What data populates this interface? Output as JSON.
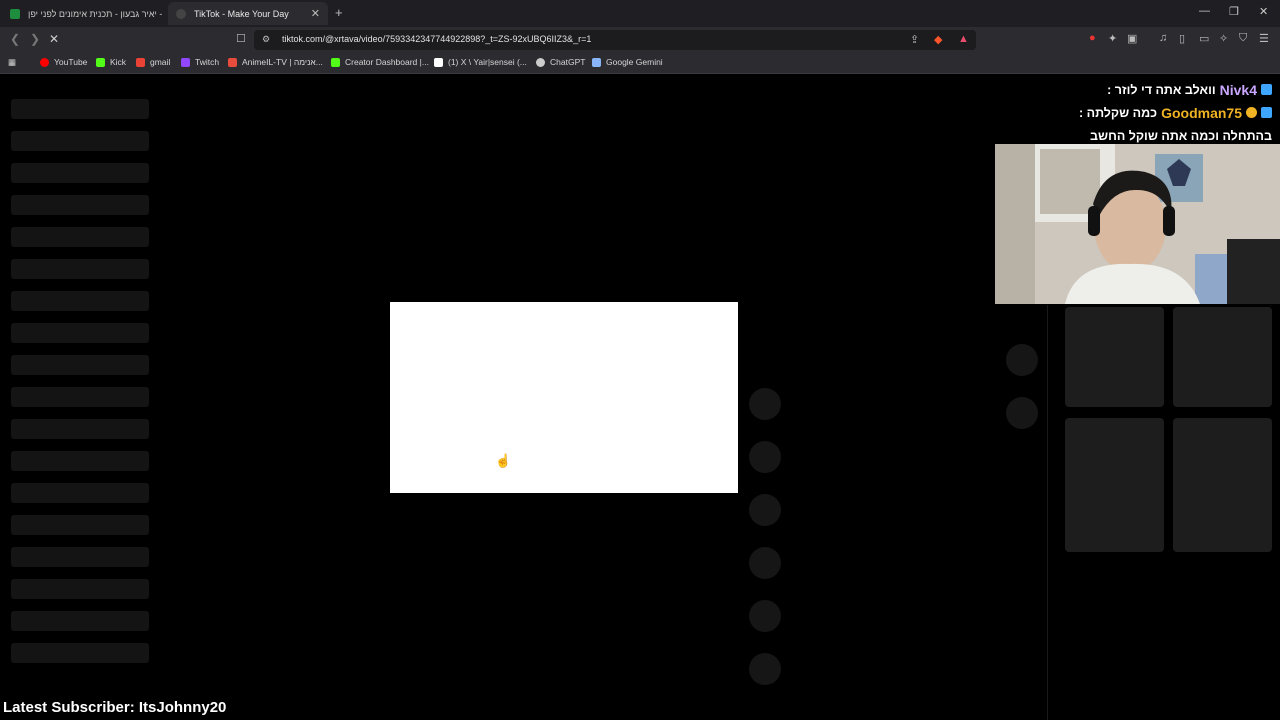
{
  "tabs": [
    {
      "title": "יאיר גבעון - תכנית אימונים לפני יפן -",
      "active": false
    },
    {
      "title": "TikTok - Make Your Day",
      "active": true
    }
  ],
  "address": {
    "url": "tiktok.com/@xrtava/video/7593342347744922898?_t=ZS-92xUBQ6IIZ3&_r=1"
  },
  "bookmarks": [
    {
      "label": "YouTube",
      "color": "#ff0000"
    },
    {
      "label": "Kick",
      "color": "#53fc18"
    },
    {
      "label": "gmail",
      "color": "#ea4335"
    },
    {
      "label": "Twitch",
      "color": "#9146ff"
    },
    {
      "label": "AnimeIL-TV | אנימה...",
      "color": "#e84c3d"
    },
    {
      "label": "Creator Dashboard |...",
      "color": "#53fc18"
    },
    {
      "label": "(1) X \\ Yair|sensei (...",
      "color": "#ffffff"
    },
    {
      "label": "ChatGPT",
      "color": "#cccccc"
    },
    {
      "label": "Google Gemini",
      "color": "#8ab4f8"
    }
  ],
  "chat": {
    "line1": {
      "user": "Nivk4",
      "message": "וואלב אתה די לוזר :"
    },
    "line2": {
      "user": "Goodman75",
      "message": "כמה שקלתה :"
    },
    "line3": {
      "message": "בהתחלה וכמה אתה שוקל החשב"
    }
  },
  "overlay": {
    "latest_subscriber": "Latest Subscriber: ItsJohnny20"
  }
}
